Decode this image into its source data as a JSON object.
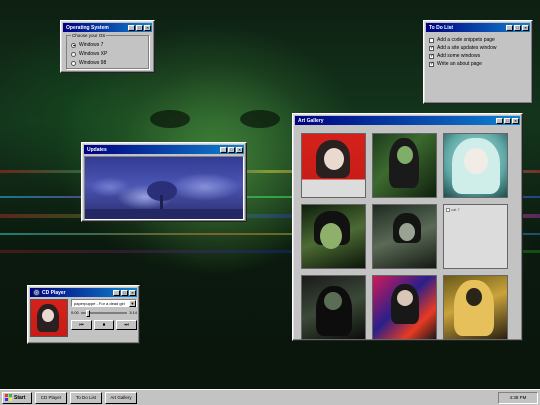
{
  "os_window": {
    "title": "Operating System",
    "legend": "Choose your OS",
    "options": [
      "Windows 7",
      "Windows XP",
      "Windows 98"
    ],
    "selected_index": 0
  },
  "todo_window": {
    "title": "To Do List",
    "items": [
      {
        "label": "Add a code snippets page",
        "checked": false
      },
      {
        "label": "Add a site updates window",
        "checked": true
      },
      {
        "label": "Add some windows",
        "checked": true
      },
      {
        "label": "Write an about page",
        "checked": true
      }
    ]
  },
  "updates_window": {
    "title": "Updates"
  },
  "gallery_window": {
    "title": "Art Gallery",
    "broken_image_alt": "cat 7"
  },
  "cd_window": {
    "title": "CD Player",
    "track": "paperpuppe - For a dead girl",
    "time_current": "0:00",
    "time_total": "3:14",
    "progress": 0.15,
    "buttons": [
      "⏮",
      "⏹",
      "⏭"
    ]
  },
  "title_buttons": {
    "minimize": "_",
    "maximize": "□",
    "close": "×"
  },
  "taskbar": {
    "start_label": "Start",
    "tasks": [
      "CD Player",
      "To Do List",
      "Art Gallery"
    ],
    "clock": "4:38 PM"
  },
  "colors": {
    "title_start": "#000080",
    "title_end": "#1084d0",
    "window_face": "#c3c3c3",
    "desktop_green": "#14351c"
  },
  "icons": [
    "window-minimize-icon",
    "window-maximize-icon",
    "window-close-icon",
    "cd-disc-icon",
    "windows-logo-icon",
    "broken-image-icon"
  ]
}
